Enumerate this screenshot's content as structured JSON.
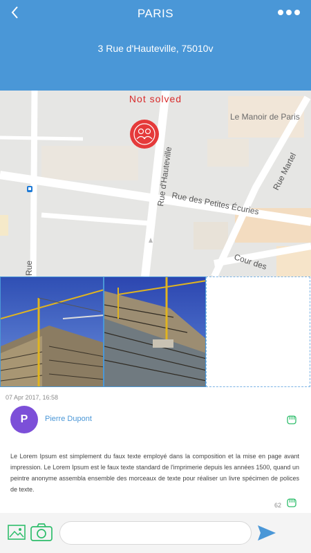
{
  "header": {
    "title": "PARIS",
    "address": "3 Rue d'Hauteville, 75010v"
  },
  "map": {
    "status": "Not solved",
    "labels": {
      "manoir": "Le Manoir de Paris",
      "hauteville": "Rue d'Hauteville",
      "petites_ecuries": "Rue des Petites Écuries",
      "martel": "Rue Martel",
      "cour": "Cour des",
      "rue_left": "Rue"
    }
  },
  "post": {
    "timestamp": "07 Apr 2017, 16:58",
    "avatar_letter": "P",
    "author": "Pierre Dupont",
    "text": "Le Lorem Ipsum est simplement du faux texte employé dans la composition et la mise en page avant impression. Le Lorem Ipsum est le faux texte standard de l'imprimerie depuis les années 1500, quand un peintre anonyme assembla ensemble des morceaux de texte pour réaliser un livre spécimen de polices de texte.",
    "count": "62"
  },
  "composer": {
    "placeholder": ""
  },
  "colors": {
    "header": "#4a97d7",
    "status": "#d82b2b",
    "avatar": "#7c4fd8",
    "accent_green": "#2ebd6b",
    "send": "#4a97d7"
  },
  "icons": [
    "back-icon",
    "more-icon",
    "map-pin-icon",
    "fist-icon",
    "gallery-icon",
    "camera-icon",
    "send-icon"
  ]
}
